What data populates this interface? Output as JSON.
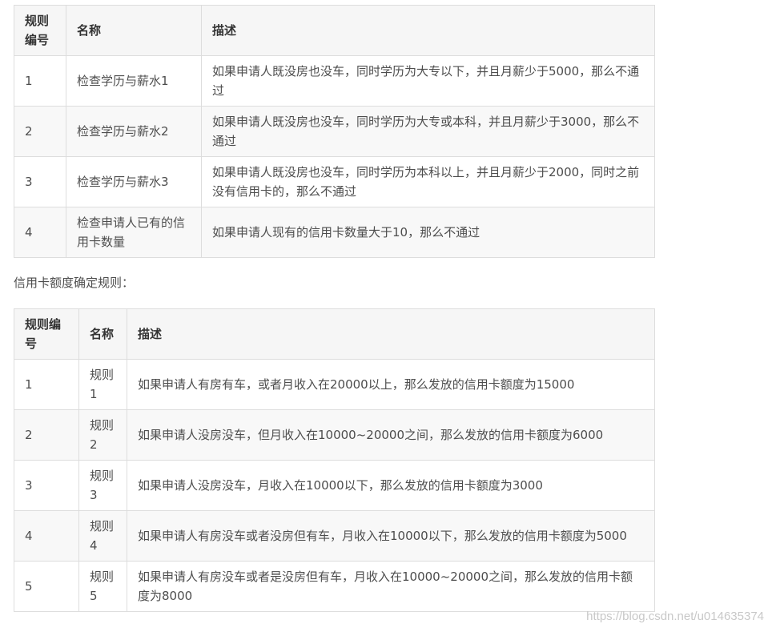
{
  "approval_table": {
    "headers": [
      "规则编号",
      "名称",
      "描述"
    ],
    "rows": [
      {
        "id": "1",
        "name": "检查学历与薪水1",
        "desc": "如果申请人既没房也没车，同时学历为大专以下，并且月薪少于5000，那么不通过"
      },
      {
        "id": "2",
        "name": "检查学历与薪水2",
        "desc": "如果申请人既没房也没车，同时学历为大专或本科，并且月薪少于3000，那么不通过"
      },
      {
        "id": "3",
        "name": "检查学历与薪水3",
        "desc": "如果申请人既没房也没车，同时学历为本科以上，并且月薪少于2000，同时之前没有信用卡的，那么不通过"
      },
      {
        "id": "4",
        "name": "检查申请人已有的信用卡数量",
        "desc": "如果申请人现有的信用卡数量大于10，那么不通过"
      }
    ]
  },
  "limit_caption": "信用卡额度确定规则：",
  "limit_table": {
    "headers": [
      "规则编号",
      "名称",
      "描述"
    ],
    "rows": [
      {
        "id": "1",
        "name": "规则1",
        "desc": "如果申请人有房有车，或者月收入在20000以上，那么发放的信用卡额度为15000"
      },
      {
        "id": "2",
        "name": "规则2",
        "desc": "如果申请人没房没车，但月收入在10000~20000之间，那么发放的信用卡额度为6000"
      },
      {
        "id": "3",
        "name": "规则3",
        "desc": "如果申请人没房没车，月收入在10000以下，那么发放的信用卡额度为3000"
      },
      {
        "id": "4",
        "name": "规则4",
        "desc": "如果申请人有房没车或者没房但有车，月收入在10000以下，那么发放的信用卡额度为5000"
      },
      {
        "id": "5",
        "name": "规则5",
        "desc": "如果申请人有房没车或者是没房但有车，月收入在10000~20000之间，那么发放的信用卡额度为8000"
      }
    ]
  },
  "watermark": "https://blog.csdn.net/u014635374"
}
